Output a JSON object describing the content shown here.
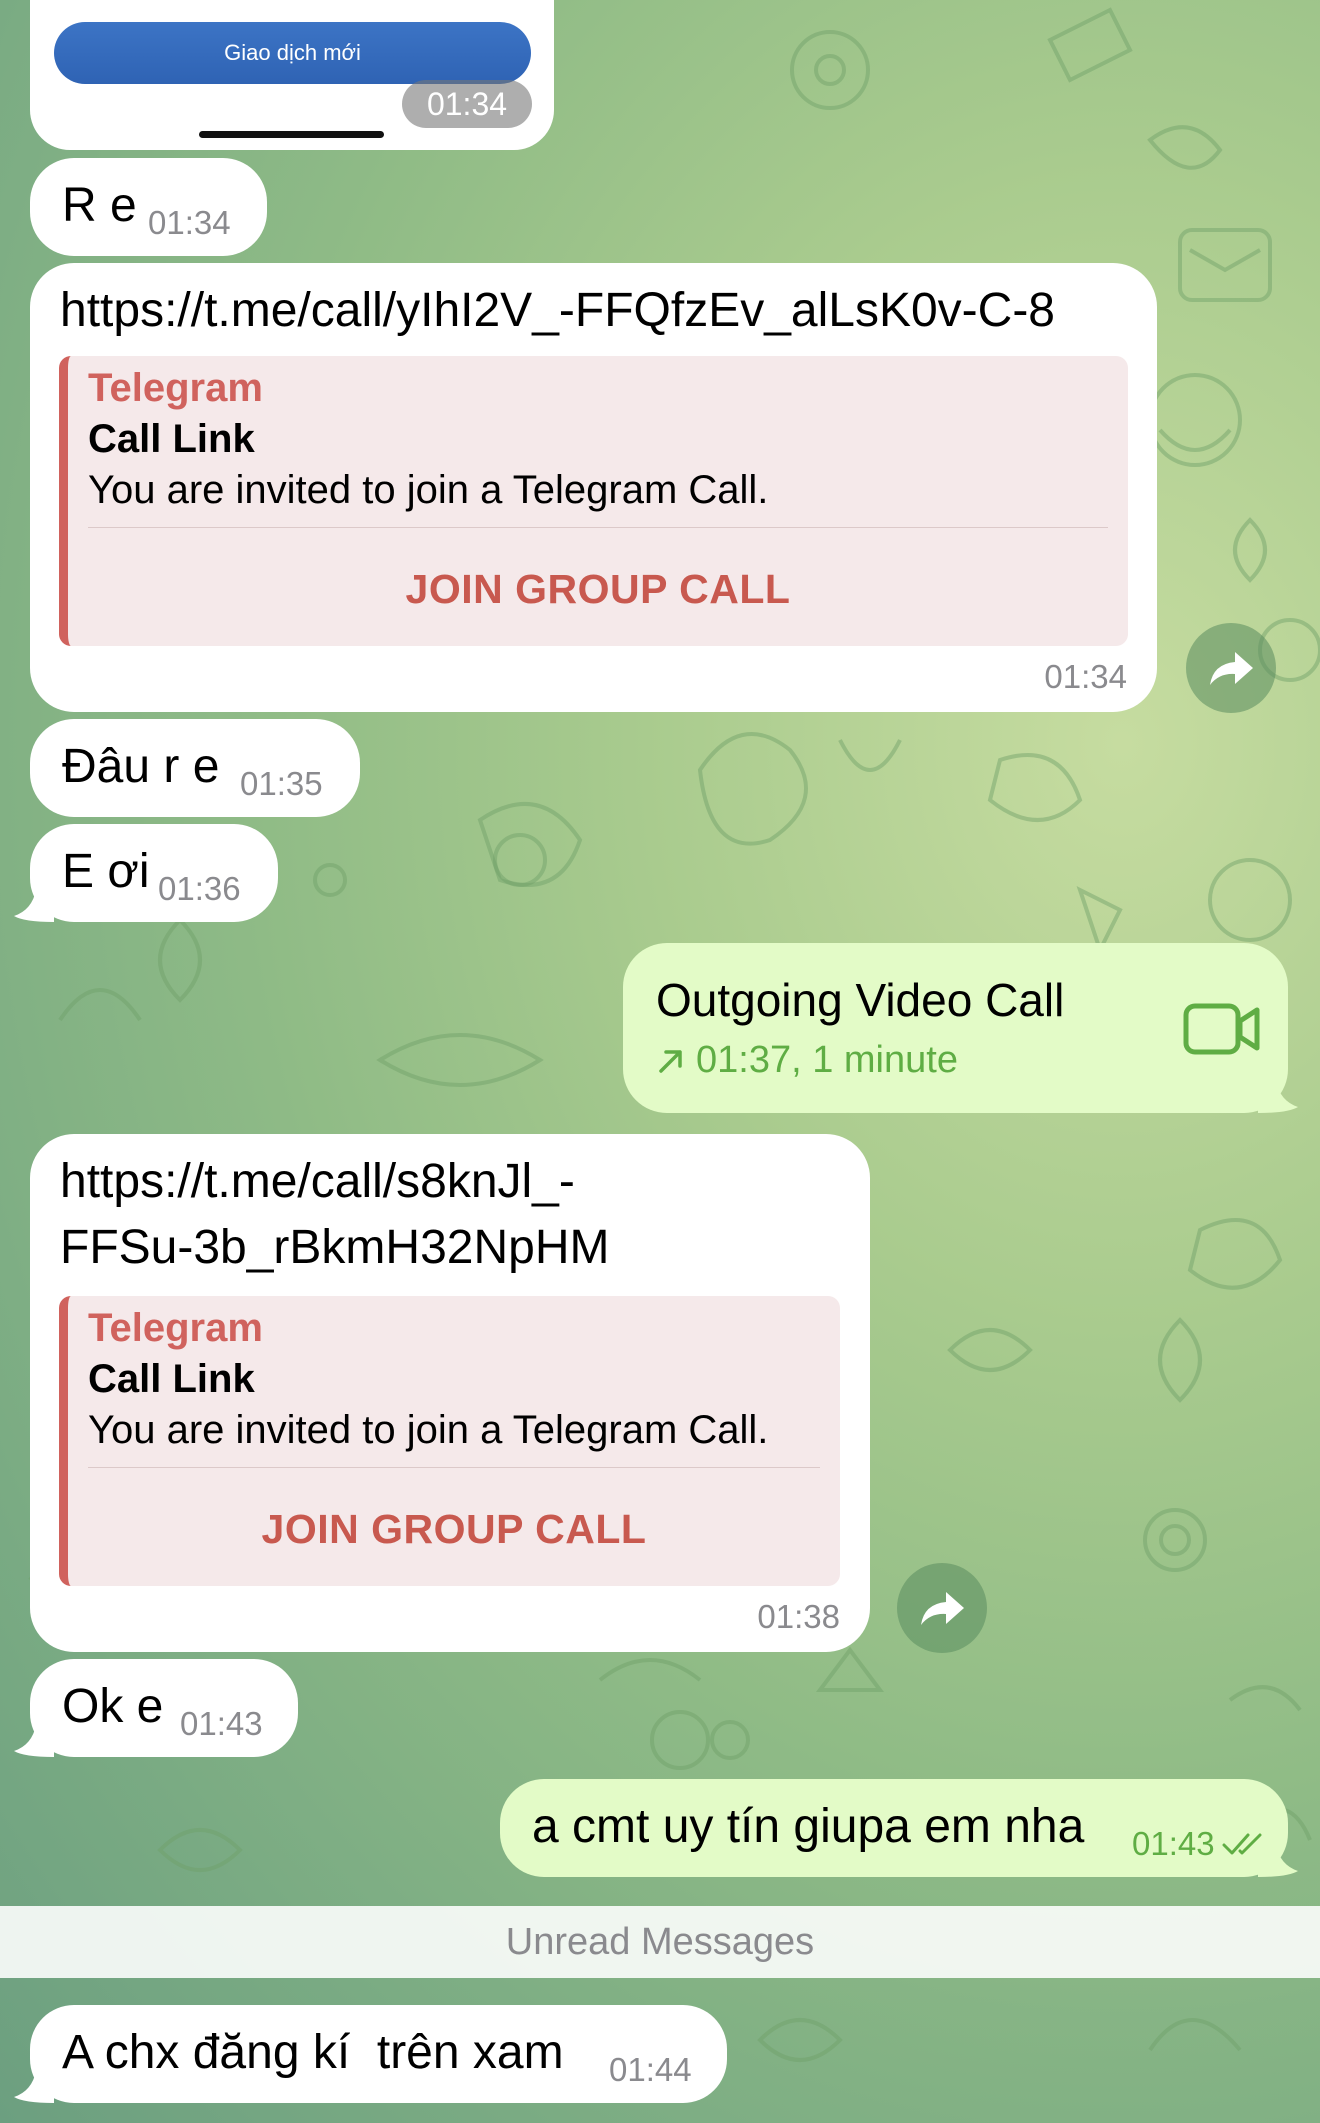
{
  "promo": {
    "button_label": "Giao dịch mới",
    "time": "01:34"
  },
  "messages": [
    {
      "text": "R e",
      "time": "01:34"
    },
    {
      "url": "https://t.me/call/yIhI2V_-FFQfzEv_alLsK0v-C-8",
      "card": {
        "source": "Telegram",
        "title": "Call Link",
        "description": "You are invited to join a Telegram Call.",
        "action": "JOIN GROUP CALL"
      },
      "time": "01:34"
    },
    {
      "text": "Đâu r e",
      "time": "01:35"
    },
    {
      "text": "E ơi",
      "time": "01:36"
    },
    {
      "call_title": "Outgoing Video Call",
      "call_info": "01:37, 1 minute"
    },
    {
      "url_line1": "https://t.me/call/s8knJl_-",
      "url_line2": "FFSu-3b_rBkmH32NpHM",
      "card": {
        "source": "Telegram",
        "title": "Call Link",
        "description": "You are invited to join a Telegram Call.",
        "action": "JOIN GROUP CALL"
      },
      "time": "01:38"
    },
    {
      "text": "Ok e",
      "time": "01:43"
    },
    {
      "text": "a cmt uy tín giupa em nha",
      "time": "01:43"
    },
    {
      "text": "A chx đăng kí  trên xam",
      "time": "01:44"
    }
  ],
  "unread_label": "Unread Messages",
  "colors": {
    "incoming_bubble": "#ffffff",
    "outgoing_bubble": "#e3fbc7",
    "card_accent": "#d0625d",
    "outgoing_time": "#5fad44"
  },
  "icons": [
    "forward-icon",
    "video-camera-icon",
    "outgoing-arrow-icon",
    "double-check-icon"
  ]
}
